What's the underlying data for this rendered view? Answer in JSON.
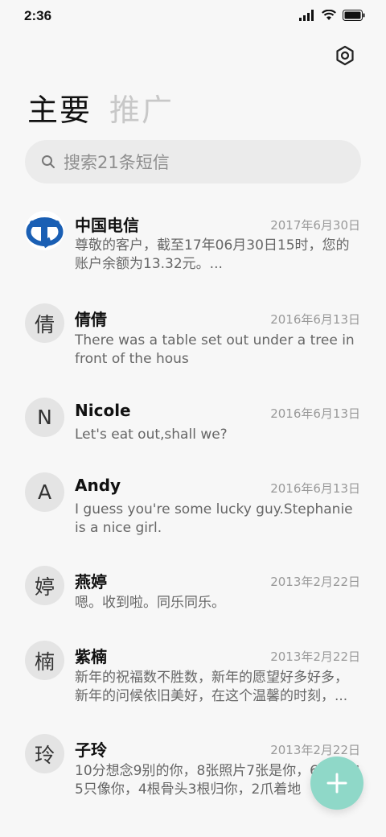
{
  "status": {
    "time": "2:36"
  },
  "header": {
    "tab_primary": "主要",
    "tab_promo": "推广"
  },
  "search": {
    "placeholder": "搜索21条短信"
  },
  "messages": [
    {
      "name": "中国电信",
      "date": "2017年6月30日",
      "preview": "尊敬的客户，截至17年06月30日15时，您的账户余额为13.32元。...",
      "avatar": "telecom-logo"
    },
    {
      "name": "倩倩",
      "date": "2016年6月13日",
      "preview": "There was a table set out under a tree in front of the hous",
      "avatar": "倩"
    },
    {
      "name": "Nicole",
      "date": "2016年6月13日",
      "preview": "Let's eat out,shall we?",
      "avatar": "N"
    },
    {
      "name": "Andy",
      "date": "2016年6月13日",
      "preview": "I guess you're some lucky guy.Stephanie is a nice girl.",
      "avatar": "A"
    },
    {
      "name": "燕婷",
      "date": "2013年2月22日",
      "preview": "嗯。收到啦。同乐同乐。",
      "avatar": "婷"
    },
    {
      "name": "紫楠",
      "date": "2013年2月22日",
      "preview": "新年的祝福数不胜数，新年的愿望好多好多，新年的问候依旧美好，在这个温馨的时刻，...",
      "avatar": "楠"
    },
    {
      "name": "子玲",
      "date": "2013年2月22日",
      "preview": "10分想念9别的你，8张照片7张是你，6只小狗5只像你，4根骨头3根归你，2爪着地",
      "avatar": "玲"
    }
  ],
  "colors": {
    "fab": "#8fd8c8",
    "telecom_blue": "#1a5fb4",
    "accent_inactive": "#c8c8c8"
  }
}
